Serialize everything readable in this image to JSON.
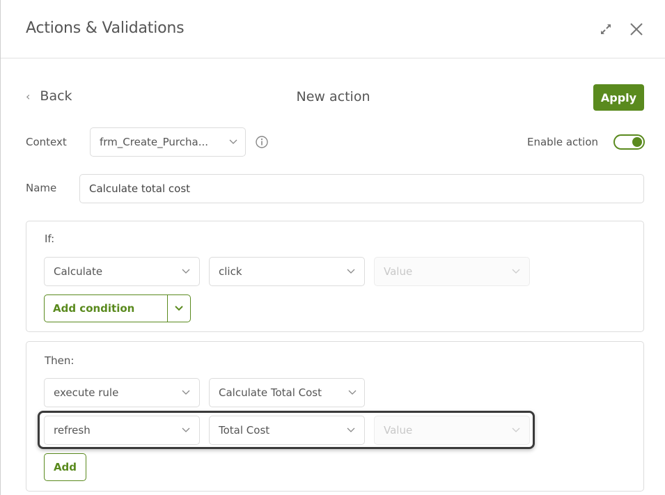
{
  "header": {
    "title": "Actions & Validations",
    "icons": [
      "expand-icon",
      "close-icon"
    ]
  },
  "nav": {
    "back_label": "Back",
    "subtitle": "New action",
    "apply_label": "Apply"
  },
  "form": {
    "context_label": "Context",
    "context_value": "frm_Create_Purcha...",
    "enable_label": "Enable action",
    "enabled": true,
    "name_label": "Name",
    "name_value": "Calculate total cost"
  },
  "if_section": {
    "title": "If:",
    "condition": {
      "field": "Calculate",
      "event": "click",
      "value_placeholder": "Value"
    },
    "add_condition_label": "Add condition"
  },
  "then_section": {
    "title": "Then:",
    "rows": [
      {
        "action": "execute rule",
        "target": "Calculate Total Cost"
      },
      {
        "action": "refresh",
        "target": "Total Cost",
        "value_placeholder": "Value"
      }
    ],
    "add_label": "Add"
  },
  "colors": {
    "accent": "#5a8a1e",
    "text": "#555555",
    "border": "#dcdcdc"
  }
}
